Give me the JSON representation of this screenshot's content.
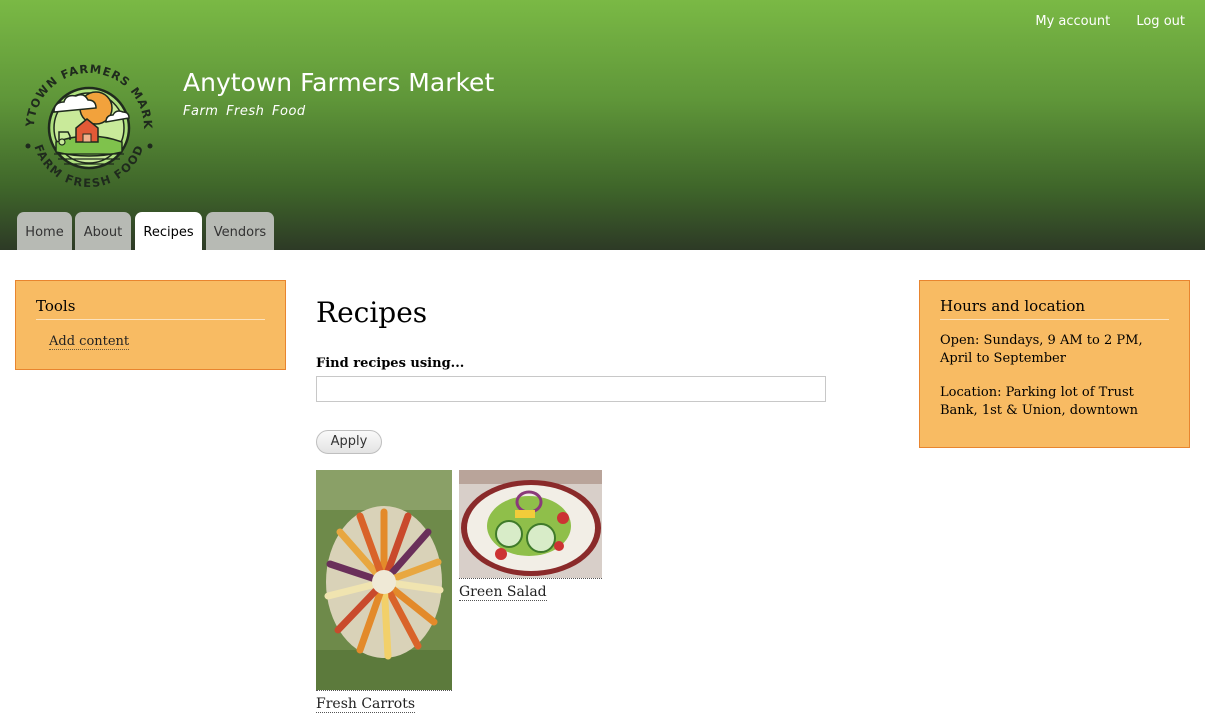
{
  "header": {
    "site_name": "Anytown Farmers Market",
    "site_slogan": "Farm Fresh Food",
    "logo_text_top": "ANYTOWN FARMERS MARKET",
    "logo_text_bottom": "FARM FRESH FOOD",
    "secondary_menu": [
      "My account",
      "Log out"
    ],
    "tabs": [
      {
        "label": "Home",
        "active": false
      },
      {
        "label": "About",
        "active": false
      },
      {
        "label": "Recipes",
        "active": true
      },
      {
        "label": "Vendors",
        "active": false
      }
    ]
  },
  "sidebar_left": {
    "title": "Tools",
    "link": "Add content"
  },
  "main": {
    "title": "Recipes",
    "search_label": "Find recipes using...",
    "search_value": "",
    "apply_label": "Apply",
    "recipes": [
      {
        "title": "Fresh Carrots",
        "image": "carrots-photo"
      },
      {
        "title": "Green Salad",
        "image": "salad-photo"
      }
    ]
  },
  "sidebar_right": {
    "title": "Hours and location",
    "open": "Open: Sundays, 9 AM to 2 PM, April to September",
    "location": "Location: Parking lot of Trust Bank, 1st & Union, downtown"
  },
  "colors": {
    "header_top": "#7ab945",
    "header_bottom": "#2d3a26",
    "block_bg": "#f8bb63",
    "block_border": "#e8852f"
  }
}
